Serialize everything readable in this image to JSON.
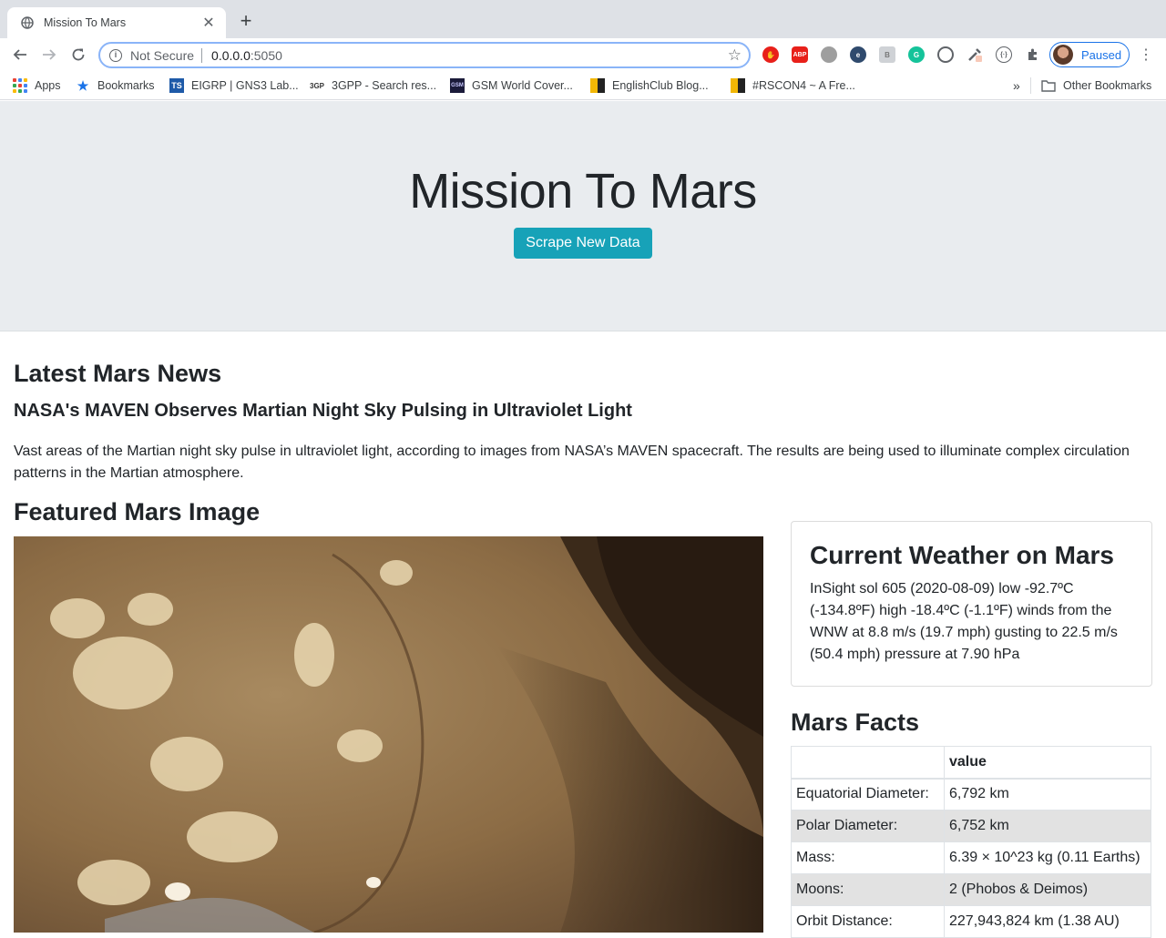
{
  "browser": {
    "tab_title": "Mission To Mars",
    "close_glyph": "✕",
    "newtab_glyph": "+",
    "security_text": "Not Secure",
    "url_host": "0.0.0.0",
    "url_port": ":5050",
    "profile_label": "Paused",
    "extensions": [
      "adblock-icon",
      "abp-icon",
      "ext-circle-icon",
      "ext-e-icon",
      "ext-b-icon",
      "grammarly-icon",
      "ext-clock-icon",
      "ext-eyedropper-icon",
      "ext-code-icon",
      "puzzle-icon"
    ],
    "bookmarks": [
      {
        "label": "Apps",
        "icon": "apps-grid-icon"
      },
      {
        "label": "Bookmarks",
        "icon": "star-icon"
      },
      {
        "label": "EIGRP | GNS3 Lab...",
        "icon": "ts-icon"
      },
      {
        "label": "3GPP - Search res...",
        "icon": "3gpp-icon"
      },
      {
        "label": "GSM World Cover...",
        "icon": "gsm-icon"
      },
      {
        "label": "EnglishClub Blog...",
        "icon": "englishclub-icon"
      },
      {
        "label": "#RSCON4 ~ A Fre...",
        "icon": "rscon-icon"
      }
    ],
    "overflow_glyph": "»",
    "other_bookmarks": "Other Bookmarks"
  },
  "page": {
    "title": "Mission To Mars",
    "scrape_button": "Scrape New Data",
    "news": {
      "heading": "Latest Mars News",
      "title": "NASA's MAVEN Observes Martian Night Sky Pulsing in Ultraviolet Light",
      "paragraph": "Vast areas of the Martian night sky pulse in ultraviolet light, according to images from NASA’s MAVEN spacecraft. The results are being used to illuminate complex circulation patterns in the Martian atmosphere."
    },
    "featured": {
      "heading": "Featured Mars Image"
    },
    "weather": {
      "heading": "Current Weather on Mars",
      "text": "InSight sol 605 (2020-08-09) low -92.7ºC (-134.8ºF) high -18.4ºC (-1.1ºF) winds from the WNW at 8.8 m/s (19.7 mph) gusting to 22.5 m/s (50.4 mph) pressure at 7.90 hPa"
    },
    "facts": {
      "heading": "Mars Facts",
      "header": [
        "",
        "value"
      ],
      "rows": [
        [
          "Equatorial Diameter:",
          "6,792 km"
        ],
        [
          "Polar Diameter:",
          "6,752 km"
        ],
        [
          "Mass:",
          "6.39 × 10^23 kg (0.11 Earths)"
        ],
        [
          "Moons:",
          "2 (Phobos & Deimos)"
        ],
        [
          "Orbit Distance:",
          "227,943,824 km (1.38 AU)"
        ]
      ]
    }
  },
  "colors": {
    "accent": "#17a2b8",
    "jumbotron": "#e9ecef",
    "focus_ring": "#8ab4f8"
  }
}
